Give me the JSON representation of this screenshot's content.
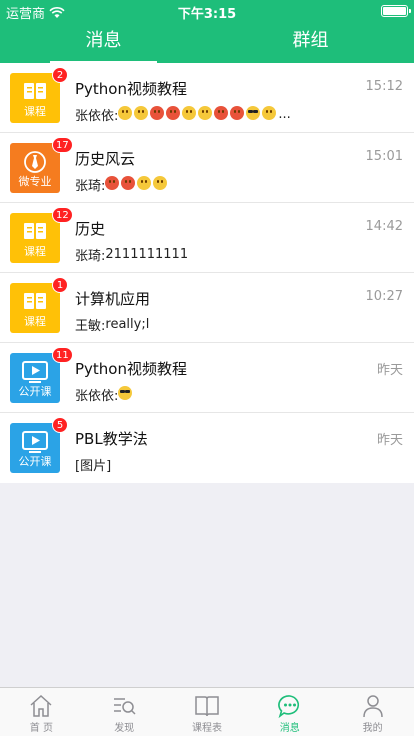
{
  "status_bar": {
    "carrier": "运营商",
    "time": "下午3:15"
  },
  "tabs": [
    {
      "label": "消息",
      "active": true
    },
    {
      "label": "群组",
      "active": false
    }
  ],
  "conversations": [
    {
      "title": "Python视频教程",
      "time": "15:12",
      "badge": "2",
      "avatar_label": "课程",
      "avatar_color": "#ffc107",
      "avatar_icon": "book-icon",
      "sender": "张依依:",
      "text": "",
      "emojis": [
        "y",
        "y",
        "r",
        "r",
        "y",
        "y",
        "r",
        "r",
        "cool",
        "y"
      ],
      "suffix": "..."
    },
    {
      "title": "历史风云",
      "time": "15:01",
      "badge": "17",
      "avatar_label": "微专业",
      "avatar_color": "#f57c1f",
      "avatar_icon": "tie-icon",
      "sender": "张琦:",
      "text": "",
      "emojis": [
        "r",
        "r",
        "y",
        "y"
      ],
      "suffix": ""
    },
    {
      "title": "历史",
      "time": "14:42",
      "badge": "12",
      "avatar_label": "课程",
      "avatar_color": "#ffc107",
      "avatar_icon": "book-icon",
      "sender": "张琦:",
      "text": "2111111111",
      "emojis": [],
      "suffix": ""
    },
    {
      "title": "计算机应用",
      "time": "10:27",
      "badge": "1",
      "avatar_label": "课程",
      "avatar_color": "#ffc107",
      "avatar_icon": "book-icon",
      "sender": "王敏:",
      "text": "really;l",
      "emojis": [],
      "suffix": ""
    },
    {
      "title": "Python视频教程",
      "time": "昨天",
      "badge": "11",
      "avatar_label": "公开课",
      "avatar_color": "#2ba3e6",
      "avatar_icon": "play-screen-icon",
      "sender": "张依依:",
      "text": "",
      "emojis": [
        "cool"
      ],
      "suffix": ""
    },
    {
      "title": "PBL教学法",
      "time": "昨天",
      "badge": "5",
      "avatar_label": "公开课",
      "avatar_color": "#2ba3e6",
      "avatar_icon": "play-screen-icon",
      "sender": "",
      "text": "[图片]",
      "emojis": [],
      "suffix": ""
    }
  ],
  "tabbar": [
    {
      "label": "首 页",
      "icon": "home-icon",
      "active": false
    },
    {
      "label": "发现",
      "icon": "discover-icon",
      "active": false
    },
    {
      "label": "课程表",
      "icon": "schedule-book-icon",
      "active": false
    },
    {
      "label": "消息",
      "icon": "message-icon",
      "active": true
    },
    {
      "label": "我的",
      "icon": "profile-icon",
      "active": false
    }
  ],
  "colors": {
    "accent": "#1ebe7a",
    "badge": "#ff2222"
  }
}
